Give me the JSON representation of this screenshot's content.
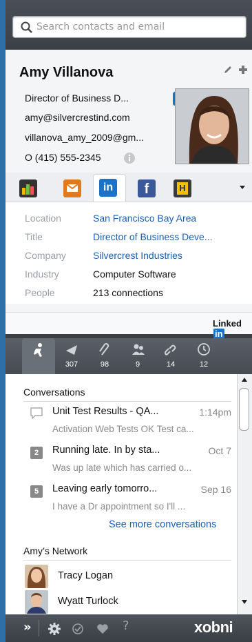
{
  "search": {
    "placeholder": "Search contacts and email"
  },
  "contact": {
    "name": "Amy Villanova",
    "title": "Director of Business D...",
    "email1": "amy@silvercrestind.com",
    "email2": "villanova_amy_2009@gm...",
    "phone": "O (415) 555-2345"
  },
  "apps": {
    "linkedin_glyph": "in",
    "facebook_glyph": "f",
    "h_glyph": "H"
  },
  "details": [
    {
      "label": "Location",
      "value": "San Francisco Bay Area",
      "link": true
    },
    {
      "label": "Title",
      "value": "Director of Business Deve...",
      "link": true
    },
    {
      "label": "Company",
      "value": "Silvercrest Industries",
      "link": true
    },
    {
      "label": "Industry",
      "value": "Computer Software",
      "link": false
    },
    {
      "label": "People",
      "value": "213 connections",
      "link": false
    }
  ],
  "linkedin_logo": {
    "text": "Linked",
    "box": "in"
  },
  "tabs": [
    {
      "icon": "profile-icon",
      "count": ""
    },
    {
      "icon": "mail-icon",
      "count": "307"
    },
    {
      "icon": "paperclip-icon",
      "count": "98"
    },
    {
      "icon": "people-icon",
      "count": "9"
    },
    {
      "icon": "link-icon",
      "count": "14"
    },
    {
      "icon": "clock-icon",
      "count": "12"
    }
  ],
  "conversations": {
    "heading": "Conversations",
    "items": [
      {
        "badge": "",
        "subject": "Unit Test Results - QA...",
        "time": "1:14pm",
        "snippet": "Activation Web Tests OK Test ca..."
      },
      {
        "badge": "2",
        "subject": "Running late. In by sta...",
        "time": "Oct 7",
        "snippet": "Was up late which has carried o..."
      },
      {
        "badge": "5",
        "subject": "Leaving early tomorro...",
        "time": "Sep 16",
        "snippet": "I have a Dr appointment so I'll ..."
      }
    ],
    "see_more": "See more conversations"
  },
  "network": {
    "heading": "Amy’s Network",
    "people": [
      "Tracy Logan",
      "Wyatt Turlock"
    ]
  },
  "bottombar": {
    "expand": "»",
    "help": "?",
    "brand": "xobni"
  },
  "colors": {
    "accent": "#2f6fa8",
    "link": "#1a5fb4",
    "linkedin": "#1a73c6"
  }
}
